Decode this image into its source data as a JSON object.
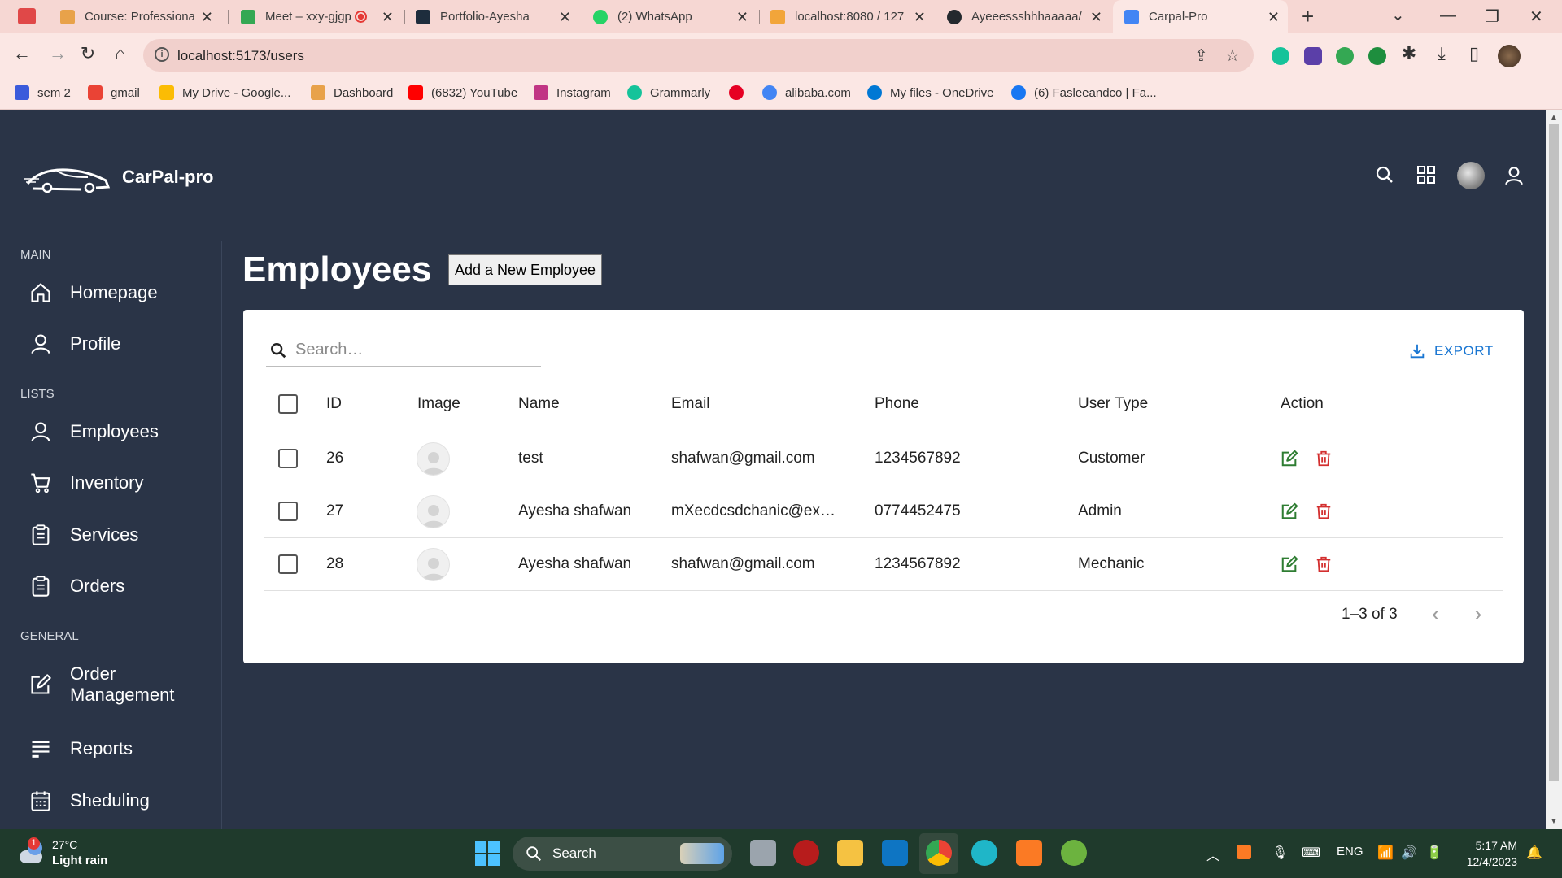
{
  "browser": {
    "tabs": [
      {
        "label": "Course: Professional",
        "color": "#e8a24a"
      },
      {
        "label": "Meet – xxy-gjgp",
        "color": "#34a853"
      },
      {
        "label": "Portfolio-Ayesha",
        "color": "#1e2d3d"
      },
      {
        "label": "(2) WhatsApp",
        "color": "#25d366"
      },
      {
        "label": "localhost:8080 / 127",
        "color": "#f2a53a"
      },
      {
        "label": "Ayeeessshhhaaaaa/",
        "color": "#24292e"
      },
      {
        "label": "Carpal-Pro",
        "color": "#4285f4"
      }
    ],
    "url": "localhost:5173/users",
    "bookmarks": [
      {
        "label": "sem 2",
        "color": "#3b5bdb"
      },
      {
        "label": "gmail",
        "color": "#ea4335"
      },
      {
        "label": "My Drive - Google...",
        "color": "#fbbc04"
      },
      {
        "label": "Dashboard",
        "color": "#e8a24a"
      },
      {
        "label": "(6832) YouTube",
        "color": "#ff0000"
      },
      {
        "label": "Instagram",
        "color": "#c13584"
      },
      {
        "label": "Grammarly",
        "color": "#15c39a"
      },
      {
        "label": "",
        "color": "#e60023"
      },
      {
        "label": "alibaba.com",
        "color": "#4285f4"
      },
      {
        "label": "My files - OneDrive",
        "color": "#0078d4"
      },
      {
        "label": "(6) Fasleeandco | Fa...",
        "color": "#1877f2"
      }
    ]
  },
  "app": {
    "brand": "CarPal-pro",
    "sidebar": {
      "sections": [
        "MAIN",
        "LISTS",
        "GENERAL"
      ],
      "items": [
        {
          "label": "Homepage",
          "icon": "home-icon"
        },
        {
          "label": "Profile",
          "icon": "user-icon"
        },
        {
          "label": "Employees",
          "icon": "user-icon"
        },
        {
          "label": "Inventory",
          "icon": "cart-icon"
        },
        {
          "label": "Services",
          "icon": "clipboard-icon"
        },
        {
          "label": "Orders",
          "icon": "clipboard-icon"
        },
        {
          "label": "Order\nManagement",
          "icon": "edit-icon"
        },
        {
          "label": "Reports",
          "icon": "list-icon"
        },
        {
          "label": "Sheduling",
          "icon": "calendar-icon"
        }
      ]
    },
    "page_title": "Employees",
    "add_button": "Add a New Employee",
    "search_placeholder": "Search…",
    "export_label": "EXPORT",
    "table": {
      "columns": [
        "ID",
        "Image",
        "Name",
        "Email",
        "Phone",
        "User Type",
        "Action"
      ],
      "rows": [
        {
          "id": "26",
          "name": "test",
          "email": "shafwan@gmail.com",
          "phone": "1234567892",
          "type": "Customer"
        },
        {
          "id": "27",
          "name": "Ayesha shafwan",
          "email": "mXecdcsdchanic@exa…",
          "phone": "0774452475",
          "type": "Admin"
        },
        {
          "id": "28",
          "name": "Ayesha shafwan",
          "email": "shafwan@gmail.com",
          "phone": "1234567892",
          "type": "Mechanic"
        }
      ],
      "pagination": "1–3 of 3"
    },
    "colors": {
      "bg": "#2a3447",
      "accent": "#1976d2",
      "edit": "#2e7d32",
      "delete": "#d32f2f"
    }
  },
  "taskbar": {
    "weather_temp": "27°C",
    "weather_desc": "Light rain",
    "weather_badge": "1",
    "search_label": "Search",
    "lang": "ENG",
    "time": "5:17 AM",
    "date": "12/4/2023"
  }
}
